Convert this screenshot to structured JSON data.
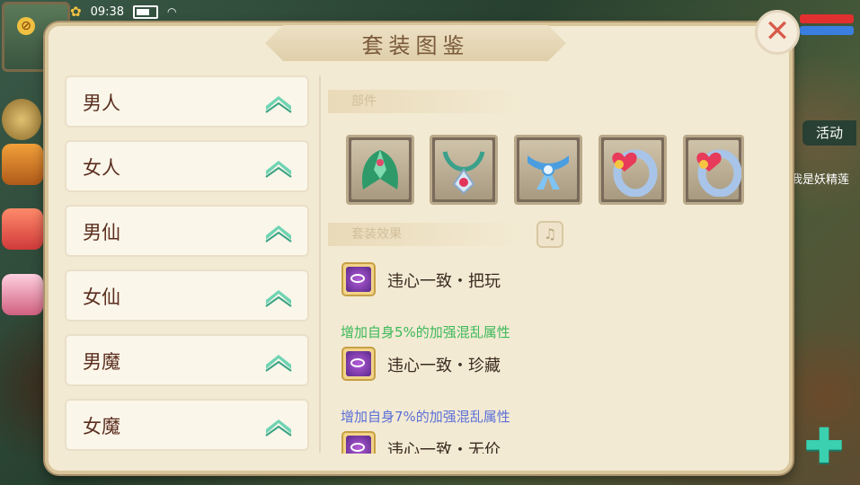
{
  "status_bar": {
    "time": "09:38"
  },
  "panel": {
    "title": "套装图鉴",
    "close_label": "✕"
  },
  "class_list": [
    {
      "label": "男人"
    },
    {
      "label": "女人"
    },
    {
      "label": "男仙"
    },
    {
      "label": "女仙"
    },
    {
      "label": "男魔"
    },
    {
      "label": "女魔"
    }
  ],
  "detail": {
    "parts_heading": "部件",
    "effects_heading": "套装效果",
    "info_icon": "info-icon",
    "items": [
      {
        "icon": "leaf-cloak-icon"
      },
      {
        "icon": "pendant-necklace-icon"
      },
      {
        "icon": "blue-ribbon-icon"
      },
      {
        "icon": "heart-ring-icon"
      },
      {
        "icon": "heart-ring-icon"
      }
    ],
    "effects": [
      {
        "name": "违心一致・把玩",
        "desc": ""
      },
      {
        "name": "违心一致・珍藏",
        "desc": "增加自身5%的加强混乱属性",
        "desc_color": "#3cb95a"
      },
      {
        "name": "违心一致・无价",
        "desc": "增加自身7%的加强混乱属性",
        "desc_color": "#5b6fd8"
      }
    ]
  },
  "side_hud": {
    "activity_label": "活动",
    "note_text": "我是妖精莲"
  },
  "colors": {
    "panel_bg": "#f3ead3",
    "item_text": "#5a2e1e",
    "chevron": "#4fc0a0",
    "close_x": "#d85a4a"
  }
}
